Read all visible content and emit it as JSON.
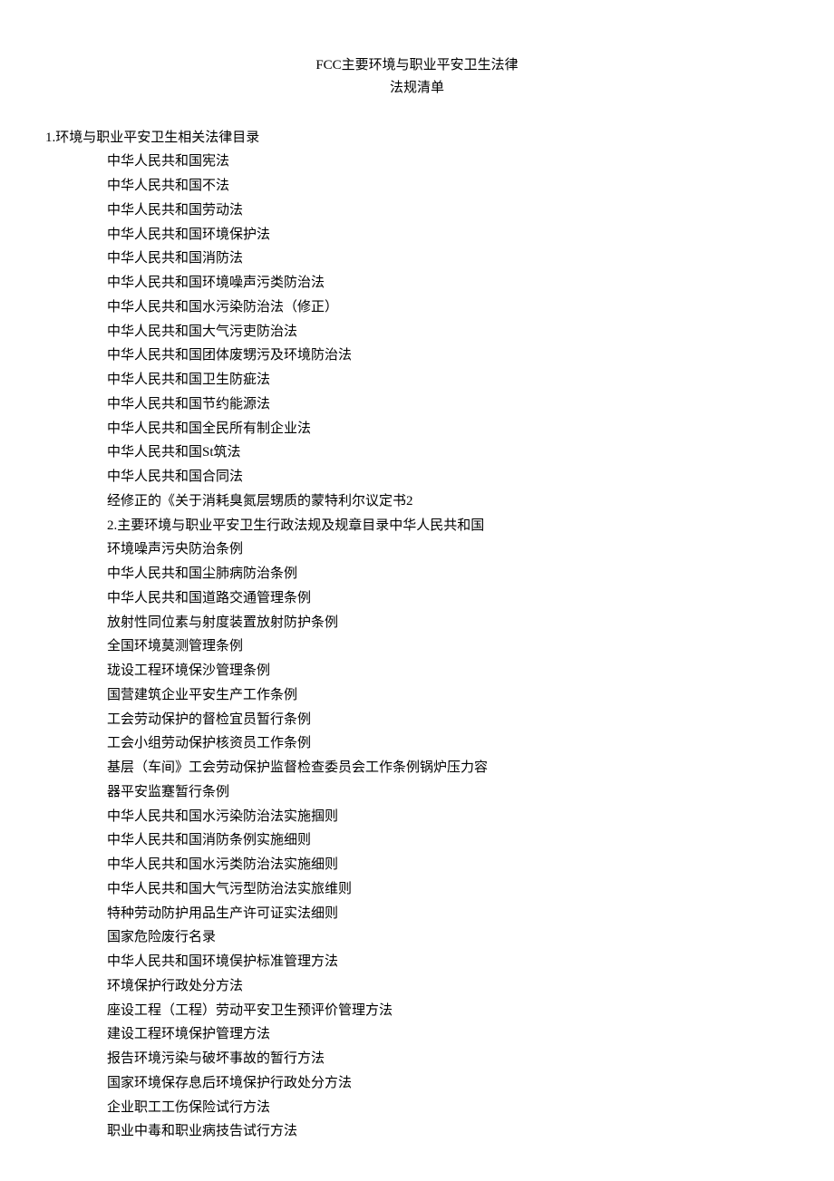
{
  "title": {
    "line1": "FCC主要环境与职业平安卫生法律",
    "line2": "法规清单"
  },
  "section1_heading": "1.环境与职业平安卫生相关法律目录",
  "items": [
    "中华人民共和国宪法",
    "中华人民共和国不法",
    "中华人民共和国劳动法",
    "中华人民共和国环境保护法",
    "中华人民共和国消防法",
    "中华人民共和国环境噪声污类防治法",
    "中华人民共和国水污染防治法（修正）",
    "中华人民共和国大气污吏防治法",
    "中华人民共和国团体废甥污及环境防治法",
    "中华人民共和国卫生防疵法",
    "中华人民共和国节约能源法",
    "中华人民共和国全民所有制企业法",
    "中华人民共和国St筑法",
    "中华人民共和国合同法",
    "经修正的《关于消耗臭氮层甥质的蒙特利尔议定书2",
    "2.主要环境与职业平安卫生行政法规及规章目录中华人民共和国",
    "环境噪声污央防治条例",
    "中华人民共和国尘肺病防治条例",
    "中华人民共和国道路交通管理条例",
    "放射性同位素与射度装置放射防护条例",
    "全国环境莫测管理条例",
    "珑设工程环境保沙管理条例",
    "国营建筑企业平安生产工作条例",
    "工会劳动保护的督检宜员暂行条例",
    "工会小组劳动保护核资员工作条例",
    "基层（车间》工会劳动保护监督检查委员会工作条例锅炉压力容",
    "器平安监蹇暂行条例",
    "中华人民共和国水污染防治法实施掴则",
    "中华人民共和国消防条例实施细则",
    "中华人民共和国水污类防治法实施细则",
    "中华人民共和国大气污型防治法实旅维则",
    "特种劳动防护用品生产许可证实法细则",
    "国家危险废行名录",
    "中华人民共和国环境俣护标准管理方法",
    "环境保护行政处分方法",
    "座设工程（工程）劳动平安卫生预评价管理方法",
    "建设工程环境保护管理方法",
    "报告环境污染与破坏事故的暂行方法",
    "国家环境保存息后环境保护行政处分方法",
    "企业职工工伤保险试行方法",
    "职业中毒和职业病技告试行方法"
  ]
}
